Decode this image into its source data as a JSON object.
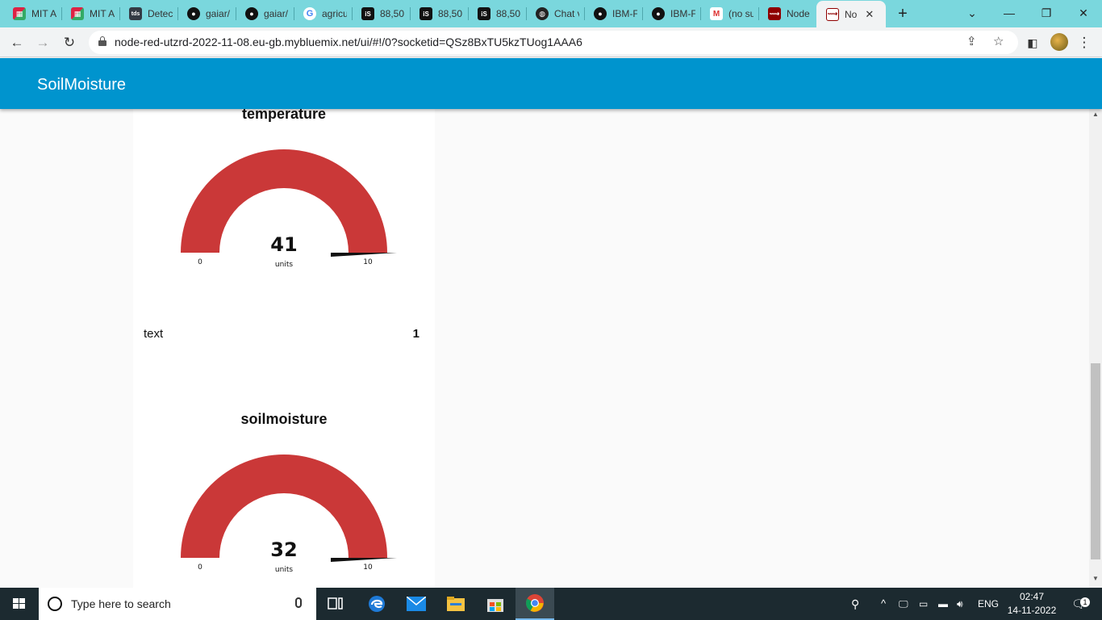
{
  "browser": {
    "tabs": [
      {
        "label": "MIT A",
        "icon": "mit-app-inventor-icon"
      },
      {
        "label": "MIT A",
        "icon": "mit-app-inventor-icon"
      },
      {
        "label": "Detec",
        "icon": "tds-icon"
      },
      {
        "label": "gaiar/",
        "icon": "github-icon"
      },
      {
        "label": "gaiar/",
        "icon": "github-icon"
      },
      {
        "label": "agricu",
        "icon": "google-icon"
      },
      {
        "label": "88,50",
        "icon": "is-icon"
      },
      {
        "label": "88,50",
        "icon": "is-icon"
      },
      {
        "label": "88,50",
        "icon": "is-icon"
      },
      {
        "label": "Chat v",
        "icon": "chat-globe-icon"
      },
      {
        "label": "IBM-F",
        "icon": "github-icon"
      },
      {
        "label": "IBM-F",
        "icon": "github-icon"
      },
      {
        "label": "(no su",
        "icon": "gmail-icon"
      },
      {
        "label": "Node",
        "icon": "node-red-icon"
      },
      {
        "label": "No",
        "icon": "node-red-icon",
        "active": true
      }
    ],
    "url": "node-red-utzrd-2022-11-08.eu-gb.mybluemix.net/ui/#!/0?socketid=QSz8BxTU5kzTUog1AAA6"
  },
  "dashboard": {
    "title": "SoilMoisture",
    "toolbar_color": "#0094ce",
    "gauges": [
      {
        "title": "temperature",
        "value": 41,
        "value_label": "41",
        "units": "units",
        "min": 0,
        "max": 10,
        "min_label": "0",
        "max_label": "10",
        "color": "#ca3838"
      },
      {
        "title": "soilmoisture",
        "value": 32,
        "value_label": "32",
        "units": "units",
        "min": 0,
        "max": 10,
        "min_label": "0",
        "max_label": "10",
        "color": "#ca3838"
      }
    ],
    "text_widget": {
      "label": "text",
      "value": "1"
    }
  },
  "taskbar": {
    "search_placeholder": "Type here to search",
    "language": "ENG",
    "time": "02:47",
    "date": "14-11-2022",
    "notification_count": "1"
  }
}
